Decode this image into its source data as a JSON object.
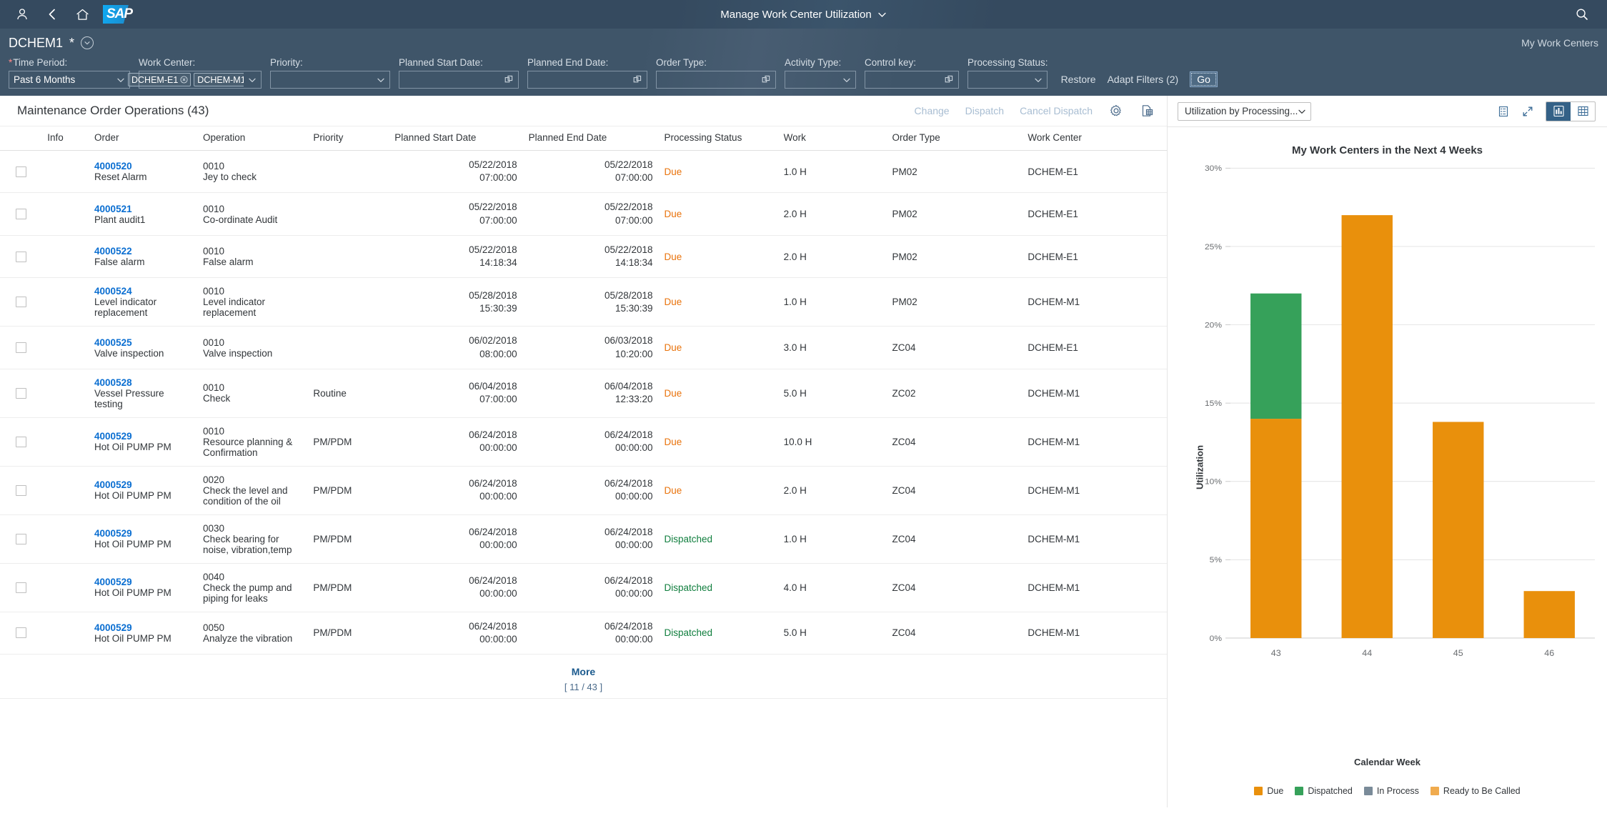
{
  "shell": {
    "title": "Manage Work Center Utilization",
    "icons": {
      "user": "user-icon",
      "back": "back-icon",
      "home": "home-icon",
      "logo": "sap-logo",
      "title_chevron": "chevron-down-icon",
      "search": "search-icon"
    }
  },
  "variant": {
    "name": "DCHEM1",
    "modified_marker": "*",
    "my_work_centers_label": "My Work Centers"
  },
  "filters": {
    "fields": [
      {
        "label": "Time Period:",
        "required": true,
        "type": "select",
        "value": "Past 6 Months",
        "placeholder": ""
      },
      {
        "label": "Work Center:",
        "required": false,
        "type": "tokens",
        "tokens": [
          "DCHEM-E1",
          "DCHEM-M1"
        ],
        "value": ""
      },
      {
        "label": "Priority:",
        "required": false,
        "type": "select",
        "value": "",
        "placeholder": ""
      },
      {
        "label": "Planned Start Date:",
        "required": false,
        "type": "valuehelp",
        "value": "",
        "placeholder": ""
      },
      {
        "label": "Planned End Date:",
        "required": false,
        "type": "valuehelp",
        "value": "",
        "placeholder": ""
      },
      {
        "label": "Order Type:",
        "required": false,
        "type": "valuehelp",
        "value": "",
        "placeholder": ""
      },
      {
        "label": "Activity Type:",
        "required": false,
        "type": "select",
        "value": "",
        "placeholder": ""
      },
      {
        "label": "Control key:",
        "required": false,
        "type": "valuehelp",
        "value": "",
        "placeholder": ""
      },
      {
        "label": "Processing Status:",
        "required": false,
        "type": "select",
        "value": "",
        "placeholder": ""
      }
    ],
    "restore_label": "Restore",
    "adapt_filters_label": "Adapt Filters (2)",
    "go_label": "Go"
  },
  "table": {
    "title": "Maintenance Order Operations (43)",
    "actions": [
      {
        "label": "Change",
        "enabled": false
      },
      {
        "label": "Dispatch",
        "enabled": false
      },
      {
        "label": "Cancel Dispatch",
        "enabled": false
      }
    ],
    "icons": {
      "settings": "gear-icon",
      "export": "export-to-spreadsheet-icon"
    },
    "columns": [
      "",
      "Info",
      "Order",
      "Operation",
      "Priority",
      "Planned Start Date",
      "Planned End Date",
      "Processing Status",
      "Work",
      "Order Type",
      "Work Center"
    ],
    "rows": [
      {
        "order": "4000520",
        "order_desc": "Reset Alarm",
        "op_num": "0010",
        "op_desc": "Jey to check",
        "priority": "",
        "start": "05/22/2018\n07:00:00",
        "end": "05/22/2018\n07:00:00",
        "status": "Due",
        "work": "1.0 H",
        "order_type": "PM02",
        "work_center": "DCHEM-E1"
      },
      {
        "order": "4000521",
        "order_desc": "Plant audit1",
        "op_num": "0010",
        "op_desc": "Co-ordinate Audit",
        "priority": "",
        "start": "05/22/2018\n07:00:00",
        "end": "05/22/2018\n07:00:00",
        "status": "Due",
        "work": "2.0 H",
        "order_type": "PM02",
        "work_center": "DCHEM-E1"
      },
      {
        "order": "4000522",
        "order_desc": "False alarm",
        "op_num": "0010",
        "op_desc": "False alarm",
        "priority": "",
        "start": "05/22/2018\n14:18:34",
        "end": "05/22/2018\n14:18:34",
        "status": "Due",
        "work": "2.0 H",
        "order_type": "PM02",
        "work_center": "DCHEM-E1"
      },
      {
        "order": "4000524",
        "order_desc": "Level indicator replacement",
        "op_num": "0010",
        "op_desc": "Level indicator replacement",
        "priority": "",
        "start": "05/28/2018\n15:30:39",
        "end": "05/28/2018\n15:30:39",
        "status": "Due",
        "work": "1.0 H",
        "order_type": "PM02",
        "work_center": "DCHEM-M1"
      },
      {
        "order": "4000525",
        "order_desc": "Valve inspection",
        "op_num": "0010",
        "op_desc": "Valve inspection",
        "priority": "",
        "start": "06/02/2018\n08:00:00",
        "end": "06/03/2018\n10:20:00",
        "status": "Due",
        "work": "3.0 H",
        "order_type": "ZC04",
        "work_center": "DCHEM-E1"
      },
      {
        "order": "4000528",
        "order_desc": "Vessel Pressure testing",
        "op_num": "0010",
        "op_desc": "Check",
        "priority": "Routine",
        "start": "06/04/2018\n07:00:00",
        "end": "06/04/2018\n12:33:20",
        "status": "Due",
        "work": "5.0 H",
        "order_type": "ZC02",
        "work_center": "DCHEM-M1"
      },
      {
        "order": "4000529",
        "order_desc": "Hot Oil PUMP PM",
        "op_num": "0010",
        "op_desc": "Resource planning & Confirmation",
        "priority": "PM/PDM",
        "start": "06/24/2018\n00:00:00",
        "end": "06/24/2018\n00:00:00",
        "status": "Due",
        "work": "10.0 H",
        "order_type": "ZC04",
        "work_center": "DCHEM-M1"
      },
      {
        "order": "4000529",
        "order_desc": "Hot Oil PUMP PM",
        "op_num": "0020",
        "op_desc": "Check the level and condition of the oil",
        "priority": "PM/PDM",
        "start": "06/24/2018\n00:00:00",
        "end": "06/24/2018\n00:00:00",
        "status": "Due",
        "work": "2.0 H",
        "order_type": "ZC04",
        "work_center": "DCHEM-M1"
      },
      {
        "order": "4000529",
        "order_desc": "Hot Oil PUMP PM",
        "op_num": "0030",
        "op_desc": "Check bearing for noise, vibration,temp",
        "priority": "PM/PDM",
        "start": "06/24/2018\n00:00:00",
        "end": "06/24/2018\n00:00:00",
        "status": "Dispatched",
        "work": "1.0 H",
        "order_type": "ZC04",
        "work_center": "DCHEM-M1"
      },
      {
        "order": "4000529",
        "order_desc": "Hot Oil PUMP PM",
        "op_num": "0040",
        "op_desc": "Check the pump and piping for leaks",
        "priority": "PM/PDM",
        "start": "06/24/2018\n00:00:00",
        "end": "06/24/2018\n00:00:00",
        "status": "Dispatched",
        "work": "4.0 H",
        "order_type": "ZC04",
        "work_center": "DCHEM-M1"
      },
      {
        "order": "4000529",
        "order_desc": "Hot Oil PUMP PM",
        "op_num": "0050",
        "op_desc": "Analyze the vibration",
        "priority": "PM/PDM",
        "start": "06/24/2018\n00:00:00",
        "end": "06/24/2018\n00:00:00",
        "status": "Dispatched",
        "work": "5.0 H",
        "order_type": "ZC04",
        "work_center": "DCHEM-M1"
      }
    ],
    "more_label": "More",
    "more_count": "[ 11 / 43 ]"
  },
  "chart_panel": {
    "view_select_value": "Utilization by Processing...",
    "icons": {
      "details": "legend-details-icon",
      "fullscreen": "full-screen-icon",
      "chart_view": "bar-chart-icon",
      "table_view": "table-view-icon"
    },
    "active_view": "chart"
  },
  "chart_data": {
    "type": "bar",
    "stacked": true,
    "title": "My Work Centers in the Next 4 Weeks",
    "xlabel": "Calendar Week",
    "ylabel": "Utilization",
    "categories": [
      "43",
      "44",
      "45",
      "46"
    ],
    "ylim": [
      0,
      30
    ],
    "yticks": [
      0,
      5,
      10,
      15,
      20,
      25,
      30
    ],
    "ytick_labels": [
      "0%",
      "5%",
      "10%",
      "15%",
      "20%",
      "25%",
      "30%"
    ],
    "grid": true,
    "legend_position": "bottom",
    "series": [
      {
        "name": "Due",
        "color": "#e9900c",
        "values": [
          14.0,
          27.0,
          13.8,
          3.0
        ]
      },
      {
        "name": "Dispatched",
        "color": "#36a15a",
        "values": [
          8.0,
          0,
          0,
          0
        ]
      },
      {
        "name": "In Process",
        "color": "#7a8b99",
        "values": [
          0,
          0,
          0,
          0
        ]
      },
      {
        "name": "Ready to Be Called",
        "color": "#f0ab4e",
        "values": [
          0,
          0,
          0,
          0
        ]
      }
    ]
  },
  "colors": {
    "shell_bg": "#354a5f",
    "filter_bg": "#3f5569",
    "link": "#0a6ed1",
    "status_due": "#e9730c",
    "status_dispatched": "#107e3e",
    "accent": "#346187"
  }
}
